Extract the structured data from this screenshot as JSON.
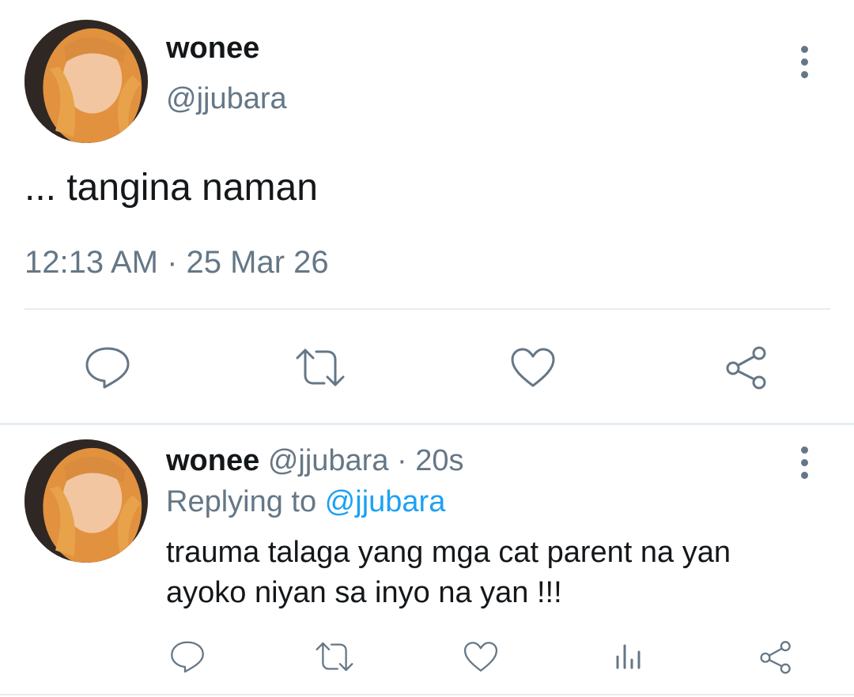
{
  "main_tweet": {
    "display_name": "wonee",
    "handle": "@jjubara",
    "text": "... tangina naman",
    "timestamp": "12:13 AM · 25 Mar 26"
  },
  "reply": {
    "display_name": "wonee",
    "handle": "@jjubara",
    "separator": " · ",
    "age": "20s",
    "replying_prefix": "Replying to ",
    "replying_to": "@jjubara",
    "text_line1": "trauma talaga yang mga cat parent na yan",
    "text_line2": "ayoko niyan sa inyo na yan !!!"
  },
  "icons": {
    "more": "more-vertical-icon",
    "reply": "reply-icon",
    "retweet": "retweet-icon",
    "like": "heart-icon",
    "share": "share-icon",
    "analytics": "analytics-icon"
  },
  "colors": {
    "text_primary": "#14171a",
    "text_secondary": "#657786",
    "link": "#1da1f2",
    "divider": "#e6ecf0"
  }
}
